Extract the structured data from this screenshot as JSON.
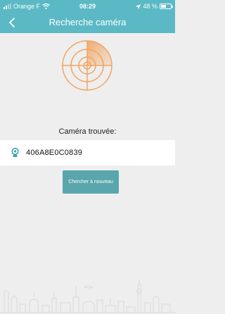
{
  "status_bar": {
    "carrier": "Orange F",
    "time": "08:29",
    "battery": "48 %",
    "battery_level": 0.48
  },
  "header": {
    "title": "Recherche caméra",
    "back_icon": "chevron-left-icon"
  },
  "main": {
    "radar_icon": "radar-icon",
    "found_label": "Caméra trouvée:",
    "device": {
      "icon": "camera-icon",
      "id": "406A8E0C0839"
    },
    "search_again_label": "Chercher à nouveau"
  },
  "colors": {
    "header": "#5bb9c5",
    "accent": "#f2a561",
    "button": "#5aa6ad",
    "background": "#eeeeee"
  }
}
